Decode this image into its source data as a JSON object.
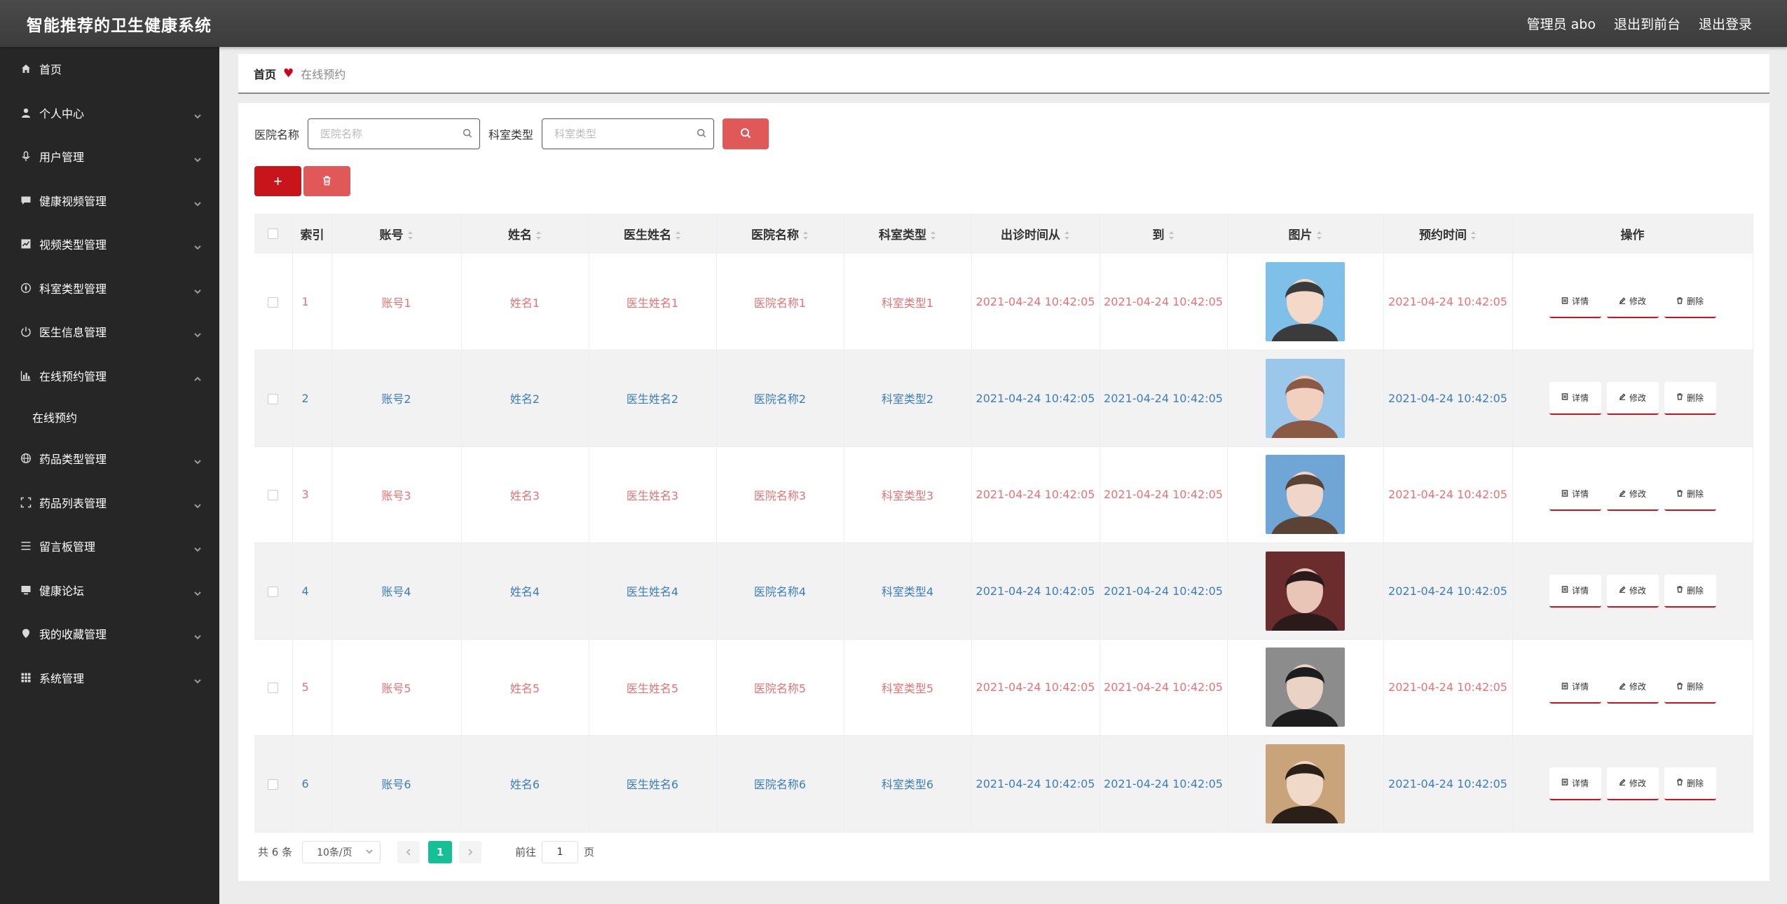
{
  "header": {
    "title": "智能推荐的卫生健康系统",
    "user": "管理员 abo",
    "to_front": "退出到前台",
    "logout": "退出登录"
  },
  "sidebar": {
    "items": [
      {
        "label": "首页",
        "icon": "home-icon",
        "chevron": false
      },
      {
        "label": "个人中心",
        "icon": "user-icon",
        "chevron": true
      },
      {
        "label": "用户管理",
        "icon": "microphone-icon",
        "chevron": true
      },
      {
        "label": "健康视频管理",
        "icon": "chat-icon",
        "chevron": true
      },
      {
        "label": "视频类型管理",
        "icon": "chart-icon",
        "chevron": true
      },
      {
        "label": "科室类型管理",
        "icon": "compass-icon",
        "chevron": true
      },
      {
        "label": "医生信息管理",
        "icon": "power-icon",
        "chevron": true
      },
      {
        "label": "在线预约管理",
        "icon": "bar-chart-icon",
        "chevron": true,
        "expanded": true
      },
      {
        "label": "药品类型管理",
        "icon": "globe-icon",
        "chevron": true
      },
      {
        "label": "药品列表管理",
        "icon": "frame-icon",
        "chevron": true
      },
      {
        "label": "留言板管理",
        "icon": "list-icon",
        "chevron": true
      },
      {
        "label": "健康论坛",
        "icon": "monitor-icon",
        "chevron": true
      },
      {
        "label": "我的收藏管理",
        "icon": "pin-icon",
        "chevron": true
      },
      {
        "label": "系统管理",
        "icon": "grid-icon",
        "chevron": true
      }
    ],
    "sub_item": "在线预约"
  },
  "breadcrumb": {
    "home": "首页",
    "current": "在线预约"
  },
  "search": {
    "hospital_label": "医院名称",
    "hospital_placeholder": "医院名称",
    "dept_label": "科室类型",
    "dept_placeholder": "科室类型"
  },
  "actions": {
    "add": "+"
  },
  "table": {
    "headers": [
      "索引",
      "账号",
      "姓名",
      "医生姓名",
      "医院名称",
      "科室类型",
      "出诊时间从",
      "到",
      "图片",
      "预约时间",
      "操作"
    ],
    "rows": [
      {
        "index": "1",
        "account": "账号1",
        "name": "姓名1",
        "doctor": "医生姓名1",
        "hospital": "医院名称1",
        "dept": "科室类型1",
        "from": "2021-04-24 10:42:05",
        "to": "2021-04-24 10:42:05",
        "booking": "2021-04-24 10:42:05"
      },
      {
        "index": "2",
        "account": "账号2",
        "name": "姓名2",
        "doctor": "医生姓名2",
        "hospital": "医院名称2",
        "dept": "科室类型2",
        "from": "2021-04-24 10:42:05",
        "to": "2021-04-24 10:42:05",
        "booking": "2021-04-24 10:42:05"
      },
      {
        "index": "3",
        "account": "账号3",
        "name": "姓名3",
        "doctor": "医生姓名3",
        "hospital": "医院名称3",
        "dept": "科室类型3",
        "from": "2021-04-24 10:42:05",
        "to": "2021-04-24 10:42:05",
        "booking": "2021-04-24 10:42:05"
      },
      {
        "index": "4",
        "account": "账号4",
        "name": "姓名4",
        "doctor": "医生姓名4",
        "hospital": "医院名称4",
        "dept": "科室类型4",
        "from": "2021-04-24 10:42:05",
        "to": "2021-04-24 10:42:05",
        "booking": "2021-04-24 10:42:05"
      },
      {
        "index": "5",
        "account": "账号5",
        "name": "姓名5",
        "doctor": "医生姓名5",
        "hospital": "医院名称5",
        "dept": "科室类型5",
        "from": "2021-04-24 10:42:05",
        "to": "2021-04-24 10:42:05",
        "booking": "2021-04-24 10:42:05"
      },
      {
        "index": "6",
        "account": "账号6",
        "name": "姓名6",
        "doctor": "医生姓名6",
        "hospital": "医院名称6",
        "dept": "科室类型6",
        "from": "2021-04-24 10:42:05",
        "to": "2021-04-24 10:42:05",
        "booking": "2021-04-24 10:42:05"
      }
    ],
    "ops": {
      "detail": "详情",
      "edit": "修改",
      "delete": "删除"
    }
  },
  "pagination": {
    "total": "共 6 条",
    "page_size": "10条/页",
    "current_page": "1",
    "goto_label": "前往",
    "goto_value": "1",
    "page_suffix": "页"
  },
  "colors": {
    "accent": "#c8141b",
    "odd_row_text": "#e57373",
    "even_row_text": "#3a7ebf",
    "page_active": "#16c096"
  }
}
